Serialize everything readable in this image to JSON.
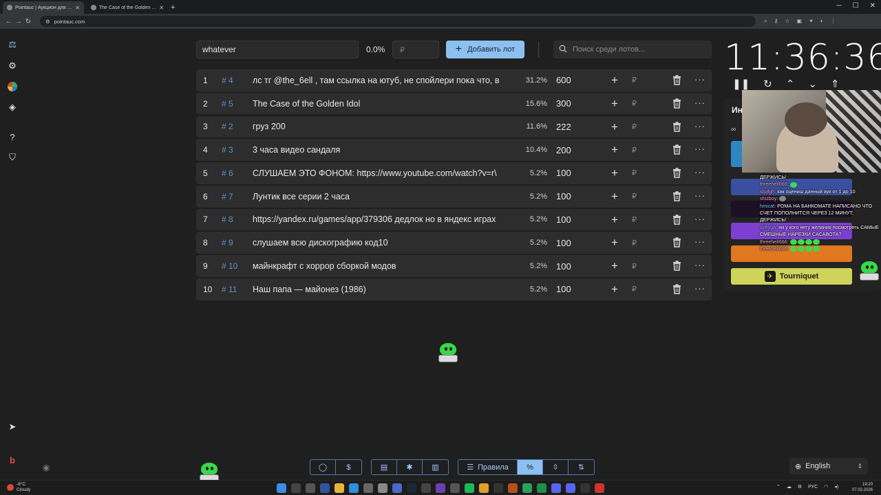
{
  "browser": {
    "tabs": [
      {
        "title": "Pointauc | Аукцион для стрима",
        "active": true
      },
      {
        "title": "The Case of the Golden Idol - S",
        "active": false
      }
    ],
    "url": "pointauc.com"
  },
  "controls": {
    "lot_input_value": "whatever",
    "percent": "0.0%",
    "amount_placeholder": "₽",
    "add_button_label": "Добавить лот",
    "search_placeholder": "Поиск среди лотов..."
  },
  "lots": [
    {
      "index": "1",
      "id": "# 4",
      "name": "лс тг @the_6ell , там ссылка на ютуб, не спойлери пока что, в",
      "percent": "31.2%",
      "amount": "600"
    },
    {
      "index": "2",
      "id": "# 5",
      "name": "The Case of the Golden Idol",
      "percent": "15.6%",
      "amount": "300"
    },
    {
      "index": "3",
      "id": "# 2",
      "name": "груз 200",
      "percent": "11.6%",
      "amount": "222"
    },
    {
      "index": "4",
      "id": "# 3",
      "name": "3 часа видео сандаля",
      "percent": "10.4%",
      "amount": "200"
    },
    {
      "index": "5",
      "id": "# 6",
      "name": "СЛУШАЕМ ЭТО ФОНОМ: https://www.youtube.com/watch?v=r\\",
      "percent": "5.2%",
      "amount": "100"
    },
    {
      "index": "6",
      "id": "# 7",
      "name": "Лунтик все серии 2 часа",
      "percent": "5.2%",
      "amount": "100"
    },
    {
      "index": "7",
      "id": "# 8",
      "name": "https://yandex.ru/games/app/379306 дедлок но в яндекс играх",
      "percent": "5.2%",
      "amount": "100"
    },
    {
      "index": "8",
      "id": "# 9",
      "name": "слушаем всю дискографию код10",
      "percent": "5.2%",
      "amount": "100"
    },
    {
      "index": "9",
      "id": "# 10",
      "name": "майнкрафт с хоррор сборкой модов",
      "percent": "5.2%",
      "amount": "100"
    },
    {
      "index": "10",
      "id": "# 11",
      "name": "Наш папа — майонез (1986)",
      "percent": "5.2%",
      "amount": "100"
    }
  ],
  "lot_row": {
    "currency": "₽",
    "add_icon": "+",
    "more_icon": "···"
  },
  "timer": {
    "value": "11:36:36"
  },
  "right_panel": {
    "title": "Ин",
    "tourniquet_label": "Tourniquet",
    "button_colors": [
      "#2e86c1",
      "#3a4fa0",
      "#1c1024",
      "#7d3fd0",
      "#e0781f"
    ]
  },
  "chat": {
    "lines": [
      {
        "user": "",
        "text": "ДЕРЖИСЬ!"
      },
      {
        "user": "threehell666:",
        "text": ""
      },
      {
        "user": "idujfgh:",
        "text": "как оцениш данный аук от 1 до 10"
      },
      {
        "user": "shizboy:",
        "text": ""
      },
      {
        "user": "hmicat:",
        "text": "РОМА НА БАНКОМАТЕ НАПИСАНО ЧТО СЧЕТ ПОПОЛНИТСЯ ЧЕРЕЗ 12 МИНУТ, ДЕРЖИСЬ!"
      },
      {
        "user": "dzhyga:",
        "text": "ни у кого нету желания посмотреть САМЫЕ СМЕШНЫЕ НАРЕЗКИ САСАВОТА?"
      },
      {
        "user": "threehell666:",
        "text": ""
      },
      {
        "user": "threehell666:",
        "text": ""
      }
    ]
  },
  "toolbar": {
    "rules_label": "Правила"
  },
  "language": {
    "selected": "English"
  },
  "taskbar": {
    "weather_temp": "-8°C",
    "weather_desc": "Cloudy",
    "lang": "РУС",
    "time": "19:20",
    "date": "07.02.2026"
  }
}
